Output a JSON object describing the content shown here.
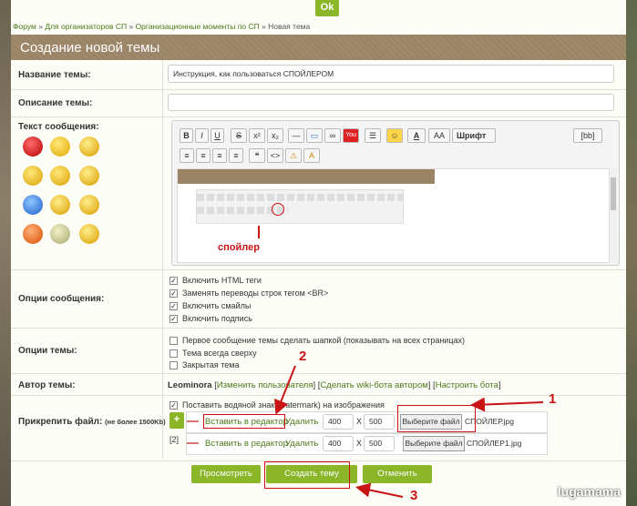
{
  "top": {
    "ok_label": "Ok"
  },
  "breadcrumb": {
    "items": [
      "Форум",
      "Для организаторов СП",
      "Организационные моменты по СП"
    ],
    "sep": "»",
    "current": "Новая тема"
  },
  "header": {
    "title": "Создание новой темы"
  },
  "form": {
    "topic_name_label": "Название темы:",
    "topic_name_value": "Инструкция, как пользоваться СПОЙЛЕРОМ",
    "topic_desc_label": "Описание темы:",
    "topic_desc_value": "",
    "message_label": "Текст сообщения:",
    "msg_options_label": "Опции сообщения:",
    "msg_options": [
      {
        "label": "Включить HTML теги",
        "checked": true
      },
      {
        "label": "Заменять переводы строк тегом <BR>",
        "checked": true
      },
      {
        "label": "Включить смайлы",
        "checked": true
      },
      {
        "label": "Включить подпись",
        "checked": true
      }
    ],
    "topic_options_label": "Опции темы:",
    "topic_options": [
      {
        "label": "Первое сообщение темы сделать шапкой (показывать на всех страницах)",
        "checked": false
      },
      {
        "label": "Тема всегда сверху",
        "checked": false
      },
      {
        "label": "Закрытая тема",
        "checked": false
      }
    ],
    "author_label": "Автор темы:",
    "author_name": "Leominora",
    "author_links": [
      "Изменить пользователя",
      "Сделать wiki-бота автором",
      "Настроить бота"
    ],
    "attach_label": "Прикрепить файл:",
    "attach_note": "(не более 1500Kb)",
    "watermark_option": "Поставить водяной знак (watermark) на изображения",
    "files": [
      {
        "index": "",
        "insert": "Вставить в редактор",
        "delete": "Удалить",
        "w": "400",
        "x": "X",
        "h": "500",
        "choose": "Выберите файл",
        "filename": "СПОЙЛЕР.jpg"
      },
      {
        "index": "[2]",
        "insert": "Вставить в редактор",
        "delete": "Удалить",
        "w": "400",
        "x": "X",
        "h": "500",
        "choose": "Выберите файл",
        "filename": "СПОЙЛЕР1.jpg"
      }
    ],
    "add_label": "+"
  },
  "editor": {
    "row1": [
      "B",
      "I",
      "U",
      "S",
      "x²",
      "x₂",
      "—",
      "▭",
      "∞",
      "You",
      "☰",
      "☺",
      "A",
      "AA",
      "Шрифт",
      "[bb]"
    ],
    "row2": [
      "≡",
      "≡",
      "≡",
      "≡",
      "❝",
      "<>",
      "⚠",
      "A"
    ],
    "inner_label": "спойлер"
  },
  "buttons": {
    "preview": "Просмотреть",
    "create": "Создать тему",
    "cancel": "Отменить"
  },
  "annotations": {
    "n1": "1",
    "n2": "2",
    "n3": "3"
  },
  "brand": {
    "watermark": "lugamama"
  },
  "colors": {
    "accent": "#8bb62a",
    "header": "#9b8466",
    "annotation": "#c81414"
  }
}
